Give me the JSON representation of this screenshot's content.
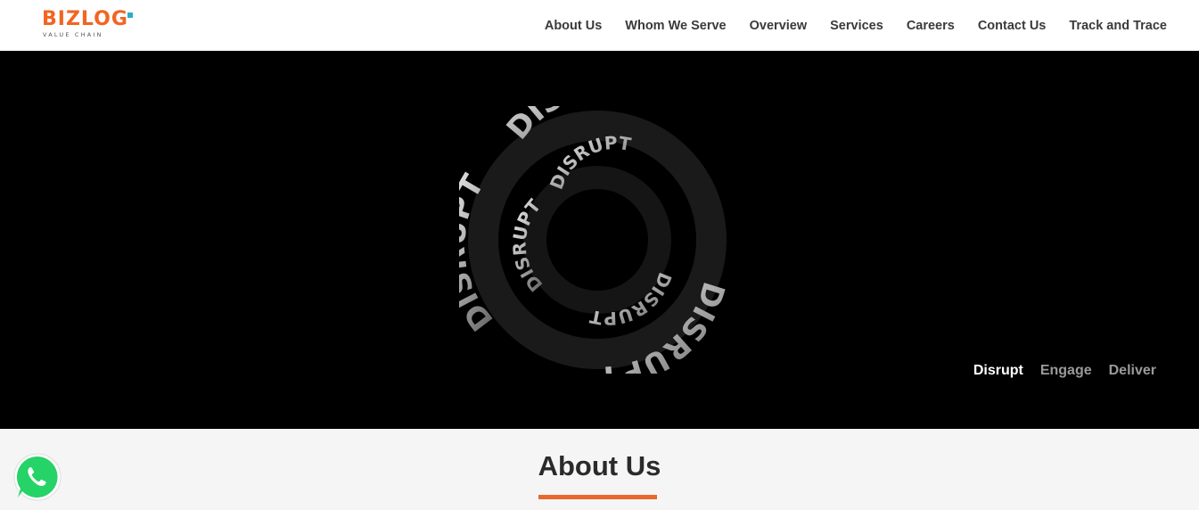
{
  "brand": {
    "name": "BIZLOG",
    "tagline": "VALUE CHAIN",
    "accent_color": "#f26522",
    "dot_color": "#2ab0c5"
  },
  "nav": {
    "items": [
      {
        "label": "About Us"
      },
      {
        "label": "Whom We Serve"
      },
      {
        "label": "Overview"
      },
      {
        "label": "Services"
      },
      {
        "label": "Careers"
      },
      {
        "label": "Contact Us"
      },
      {
        "label": "Track and Trace"
      }
    ]
  },
  "hero": {
    "swirl_word": "DISRUPT",
    "tabs": [
      {
        "label": "Disrupt",
        "active": true
      },
      {
        "label": "Engage",
        "active": false
      },
      {
        "label": "Deliver",
        "active": false
      }
    ]
  },
  "about": {
    "title": "About Us",
    "underline_color": "#e8692d"
  },
  "floating": {
    "icon": "whatsapp-icon"
  }
}
